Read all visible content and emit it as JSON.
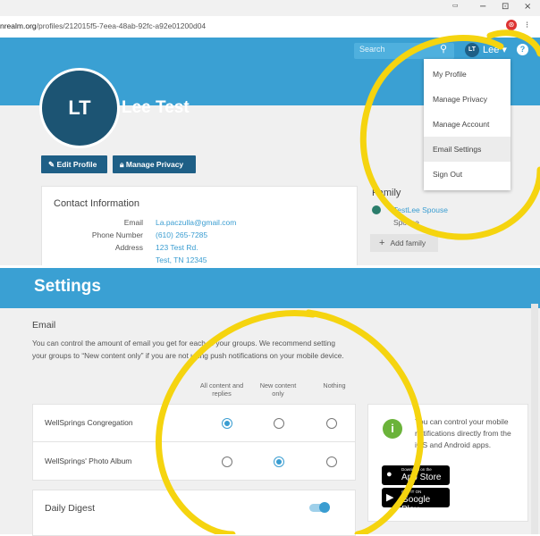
{
  "browser": {
    "url_domain": "nrealm.org",
    "url_path": "/profiles/212015f5-7eea-48ab-92fc-a92e01200d04",
    "win_min": "−",
    "win_max": "⊡",
    "win_close": "×",
    "ext_icons": [
      "⊛",
      "⁝"
    ]
  },
  "header": {
    "search_placeholder": "Search",
    "user_initials": "LT",
    "user_name": "Lee ▾",
    "help": "?"
  },
  "profile": {
    "initials": "LT",
    "name": "Lee Test",
    "edit_button": "Edit Profile",
    "privacy_button": "Manage Privacy"
  },
  "contact": {
    "title": "Contact Information",
    "rows": [
      {
        "label": "Email",
        "value": "La.paczulla@gmail.com"
      },
      {
        "label": "Phone Number",
        "value": "(610) 265-7285"
      },
      {
        "label": "Address",
        "value": "123 Test Rd."
      },
      {
        "label": "",
        "value": "Test, TN 12345"
      }
    ]
  },
  "family": {
    "title": "Family",
    "member": "TestLee Spouse",
    "relation": "Spouse",
    "add_button": "Add family"
  },
  "dropdown": {
    "items": [
      "My Profile",
      "Manage Privacy",
      "Manage Account",
      "Email Settings",
      "Sign Out"
    ],
    "highlighted_index": 3
  },
  "settings": {
    "title": "Settings",
    "email_heading": "Email",
    "email_desc_1": "You can control the amount of email you get for each of your groups. We recommend setting",
    "email_desc_2": "your groups to “New content only” if you are not using push notifications on your mobile device.",
    "columns": [
      "All content and replies",
      "New content only",
      "Nothing"
    ],
    "rows": [
      {
        "name": "WellSprings Congregation",
        "selected": 0
      },
      {
        "name": "WellSprings' Photo Album",
        "selected": 1
      }
    ],
    "digest_label": "Daily Digest",
    "digest_on": true
  },
  "info": {
    "icon": "i",
    "text": "You can control your mobile notifications directly from the iOS and Android apps.",
    "app_store_small": "Download on the",
    "app_store_large": "App Store",
    "play_small": "GET IT ON",
    "play_large": "Google Play"
  },
  "colors": {
    "brand": "#3aa0d3",
    "dark": "#1e5f86",
    "annotation": "#f5d40f"
  }
}
